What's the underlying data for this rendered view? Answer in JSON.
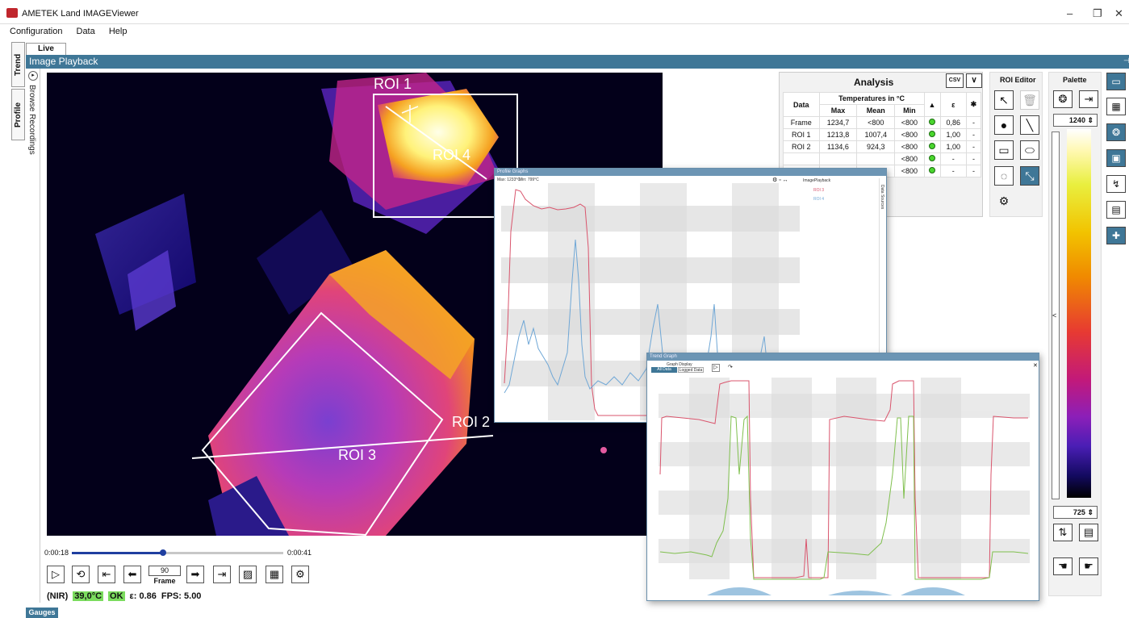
{
  "window": {
    "title": "AMETEK Land IMAGEViewer",
    "controls": {
      "minimize": "–",
      "restore": "❐",
      "close": "✕"
    }
  },
  "menu": [
    "Configuration",
    "Data",
    "Help"
  ],
  "side_tabs": [
    "Trend Graph",
    "Profile Graphs"
  ],
  "tabs": {
    "live_image": "Live Image"
  },
  "playback": {
    "title": "Image Playback",
    "browse_label": "Browse Recordings",
    "time_start": "0:00:18",
    "time_end": "0:00:41",
    "frame_value": "90",
    "frame_label": "Frame",
    "position_fraction": 0.43
  },
  "thermal_image": {
    "roi_labels": [
      "ROI 1",
      "ROI 4",
      "ROI 2",
      "ROI 3"
    ]
  },
  "status": {
    "mode": "(NIR)",
    "temp": "39,0°C",
    "ok": "OK",
    "emissivity": "ε: 0.86",
    "fps": "FPS: 5.00"
  },
  "bottom_tab": "Gauges",
  "analysis": {
    "title": "Analysis",
    "csv_label": "CSV",
    "headers": {
      "data": "Data",
      "temps": "Temperatures in °C",
      "max": "Max",
      "mean": "Mean",
      "min": "Min",
      "eps": "ε"
    },
    "rows": [
      {
        "name": "Frame",
        "max": "1234,7",
        "mean": "<800",
        "min": "<800",
        "eps": "0,86",
        "extra": "-"
      },
      {
        "name": "ROI 1",
        "max": "1213,8",
        "mean": "1007,4",
        "min": "<800",
        "eps": "1,00",
        "extra": "-"
      },
      {
        "name": "ROI 2",
        "max": "1134,6",
        "mean": "924,3",
        "min": "<800",
        "eps": "1,00",
        "extra": "-"
      },
      {
        "name": "",
        "max": "",
        "mean": "",
        "min": "<800",
        "eps": "-",
        "extra": "-"
      },
      {
        "name": "",
        "max": "",
        "mean": "",
        "min": "<800",
        "eps": "-",
        "extra": "-"
      }
    ]
  },
  "roi_editor": {
    "title": "ROI Editor"
  },
  "palette": {
    "title": "Palette",
    "max_value": "1240",
    "min_value": "725",
    "collapse_glyph": "<"
  },
  "profile_graph": {
    "title": "Profile Graphs",
    "max_label": "Max: 1233°C",
    "min_label": "Min: 799°C",
    "tree_root": "ImagePlayback",
    "items": [
      "ROI 3",
      "ROI 4"
    ],
    "side_label": "Data Sources"
  },
  "trend_graph": {
    "title": "Trend Graph",
    "display_label": "Graph Display",
    "btn_all": "All Data",
    "btn_logged": "Logged Data"
  },
  "colors": {
    "accent": "#3f7797",
    "ok_green": "#7bdc5e",
    "series_red": "#d9546c",
    "series_blue": "#6fa7d6",
    "series_green": "#7fbf4d"
  }
}
